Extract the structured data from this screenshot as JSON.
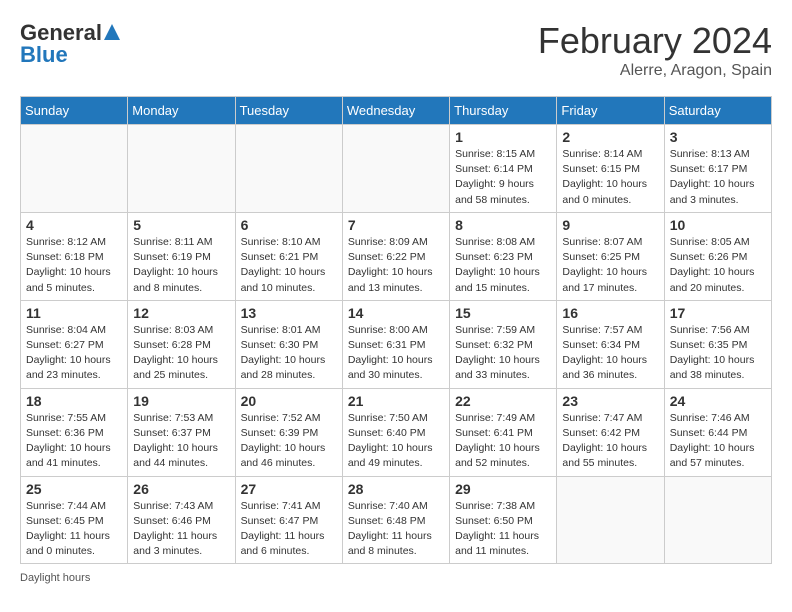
{
  "header": {
    "logo_line1": "General",
    "logo_line2": "Blue",
    "title": "February 2024",
    "subtitle": "Alerre, Aragon, Spain"
  },
  "days_of_week": [
    "Sunday",
    "Monday",
    "Tuesday",
    "Wednesday",
    "Thursday",
    "Friday",
    "Saturday"
  ],
  "weeks": [
    [
      {
        "num": "",
        "info": ""
      },
      {
        "num": "",
        "info": ""
      },
      {
        "num": "",
        "info": ""
      },
      {
        "num": "",
        "info": ""
      },
      {
        "num": "1",
        "info": "Sunrise: 8:15 AM\nSunset: 6:14 PM\nDaylight: 9 hours and 58 minutes."
      },
      {
        "num": "2",
        "info": "Sunrise: 8:14 AM\nSunset: 6:15 PM\nDaylight: 10 hours and 0 minutes."
      },
      {
        "num": "3",
        "info": "Sunrise: 8:13 AM\nSunset: 6:17 PM\nDaylight: 10 hours and 3 minutes."
      }
    ],
    [
      {
        "num": "4",
        "info": "Sunrise: 8:12 AM\nSunset: 6:18 PM\nDaylight: 10 hours and 5 minutes."
      },
      {
        "num": "5",
        "info": "Sunrise: 8:11 AM\nSunset: 6:19 PM\nDaylight: 10 hours and 8 minutes."
      },
      {
        "num": "6",
        "info": "Sunrise: 8:10 AM\nSunset: 6:21 PM\nDaylight: 10 hours and 10 minutes."
      },
      {
        "num": "7",
        "info": "Sunrise: 8:09 AM\nSunset: 6:22 PM\nDaylight: 10 hours and 13 minutes."
      },
      {
        "num": "8",
        "info": "Sunrise: 8:08 AM\nSunset: 6:23 PM\nDaylight: 10 hours and 15 minutes."
      },
      {
        "num": "9",
        "info": "Sunrise: 8:07 AM\nSunset: 6:25 PM\nDaylight: 10 hours and 17 minutes."
      },
      {
        "num": "10",
        "info": "Sunrise: 8:05 AM\nSunset: 6:26 PM\nDaylight: 10 hours and 20 minutes."
      }
    ],
    [
      {
        "num": "11",
        "info": "Sunrise: 8:04 AM\nSunset: 6:27 PM\nDaylight: 10 hours and 23 minutes."
      },
      {
        "num": "12",
        "info": "Sunrise: 8:03 AM\nSunset: 6:28 PM\nDaylight: 10 hours and 25 minutes."
      },
      {
        "num": "13",
        "info": "Sunrise: 8:01 AM\nSunset: 6:30 PM\nDaylight: 10 hours and 28 minutes."
      },
      {
        "num": "14",
        "info": "Sunrise: 8:00 AM\nSunset: 6:31 PM\nDaylight: 10 hours and 30 minutes."
      },
      {
        "num": "15",
        "info": "Sunrise: 7:59 AM\nSunset: 6:32 PM\nDaylight: 10 hours and 33 minutes."
      },
      {
        "num": "16",
        "info": "Sunrise: 7:57 AM\nSunset: 6:34 PM\nDaylight: 10 hours and 36 minutes."
      },
      {
        "num": "17",
        "info": "Sunrise: 7:56 AM\nSunset: 6:35 PM\nDaylight: 10 hours and 38 minutes."
      }
    ],
    [
      {
        "num": "18",
        "info": "Sunrise: 7:55 AM\nSunset: 6:36 PM\nDaylight: 10 hours and 41 minutes."
      },
      {
        "num": "19",
        "info": "Sunrise: 7:53 AM\nSunset: 6:37 PM\nDaylight: 10 hours and 44 minutes."
      },
      {
        "num": "20",
        "info": "Sunrise: 7:52 AM\nSunset: 6:39 PM\nDaylight: 10 hours and 46 minutes."
      },
      {
        "num": "21",
        "info": "Sunrise: 7:50 AM\nSunset: 6:40 PM\nDaylight: 10 hours and 49 minutes."
      },
      {
        "num": "22",
        "info": "Sunrise: 7:49 AM\nSunset: 6:41 PM\nDaylight: 10 hours and 52 minutes."
      },
      {
        "num": "23",
        "info": "Sunrise: 7:47 AM\nSunset: 6:42 PM\nDaylight: 10 hours and 55 minutes."
      },
      {
        "num": "24",
        "info": "Sunrise: 7:46 AM\nSunset: 6:44 PM\nDaylight: 10 hours and 57 minutes."
      }
    ],
    [
      {
        "num": "25",
        "info": "Sunrise: 7:44 AM\nSunset: 6:45 PM\nDaylight: 11 hours and 0 minutes."
      },
      {
        "num": "26",
        "info": "Sunrise: 7:43 AM\nSunset: 6:46 PM\nDaylight: 11 hours and 3 minutes."
      },
      {
        "num": "27",
        "info": "Sunrise: 7:41 AM\nSunset: 6:47 PM\nDaylight: 11 hours and 6 minutes."
      },
      {
        "num": "28",
        "info": "Sunrise: 7:40 AM\nSunset: 6:48 PM\nDaylight: 11 hours and 8 minutes."
      },
      {
        "num": "29",
        "info": "Sunrise: 7:38 AM\nSunset: 6:50 PM\nDaylight: 11 hours and 11 minutes."
      },
      {
        "num": "",
        "info": ""
      },
      {
        "num": "",
        "info": ""
      }
    ]
  ],
  "footer": "Daylight hours"
}
